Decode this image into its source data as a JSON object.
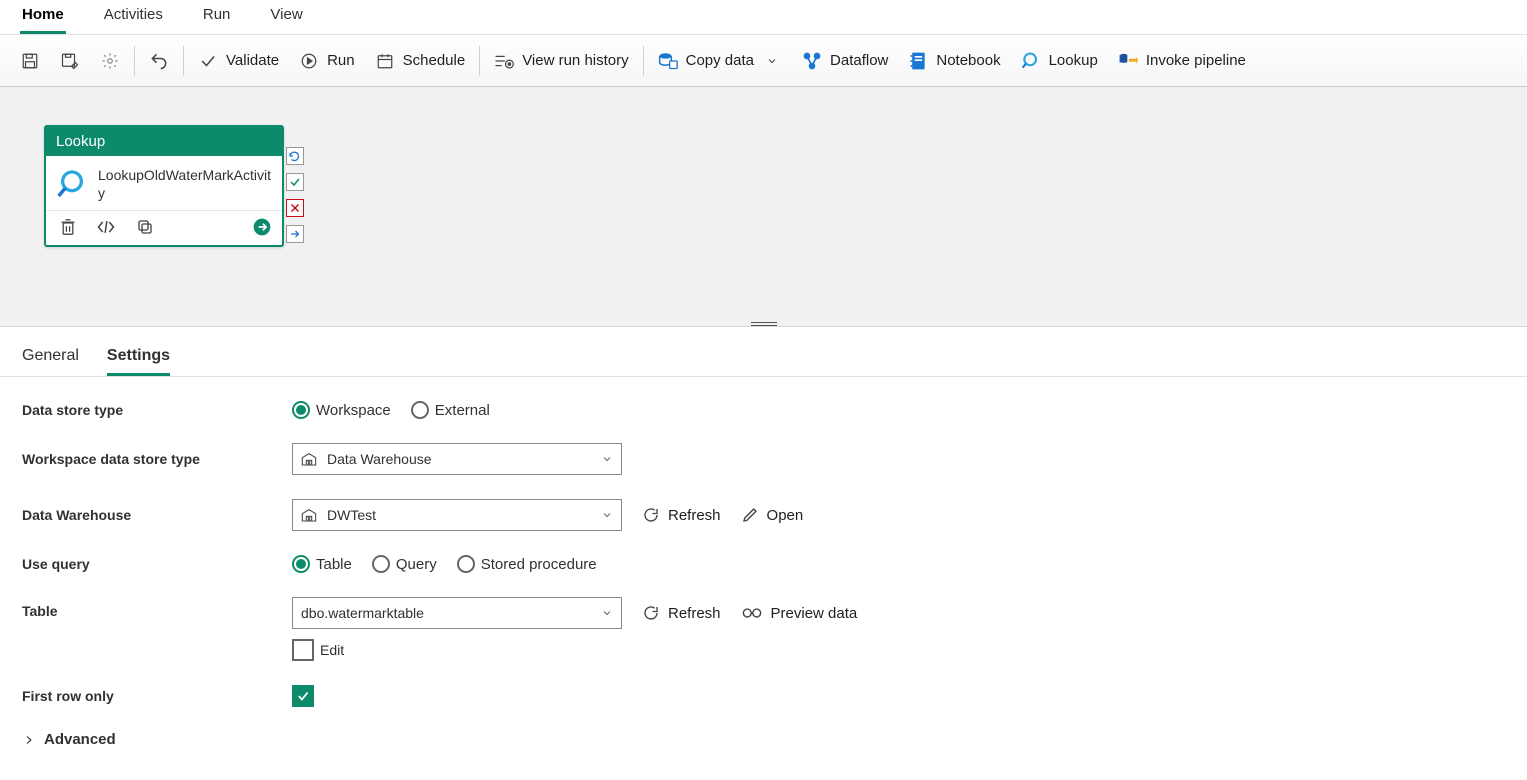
{
  "topTabs": {
    "home": "Home",
    "activities": "Activities",
    "run": "Run",
    "view": "View"
  },
  "toolbar": {
    "validate": "Validate",
    "run": "Run",
    "schedule": "Schedule",
    "viewRunHistory": "View run history",
    "copyData": "Copy data",
    "dataflow": "Dataflow",
    "notebook": "Notebook",
    "lookup": "Lookup",
    "invokePipeline": "Invoke pipeline"
  },
  "activity": {
    "type": "Lookup",
    "name": "LookupOldWaterMarkActivity"
  },
  "panelTabs": {
    "general": "General",
    "settings": "Settings"
  },
  "form": {
    "dataStoreType_lbl": "Data store type",
    "dataStoreType_opts": {
      "workspace": "Workspace",
      "external": "External"
    },
    "wsDataStoreType_lbl": "Workspace data store type",
    "wsDataStoreType_val": "Data Warehouse",
    "dataWarehouse_lbl": "Data Warehouse",
    "dataWarehouse_val": "DWTest",
    "refresh": "Refresh",
    "open": "Open",
    "useQuery_lbl": "Use query",
    "useQuery_opts": {
      "table": "Table",
      "query": "Query",
      "sp": "Stored procedure"
    },
    "table_lbl": "Table",
    "table_val": "dbo.watermarktable",
    "edit": "Edit",
    "previewData": "Preview data",
    "firstRowOnly_lbl": "First row only",
    "advanced": "Advanced"
  }
}
